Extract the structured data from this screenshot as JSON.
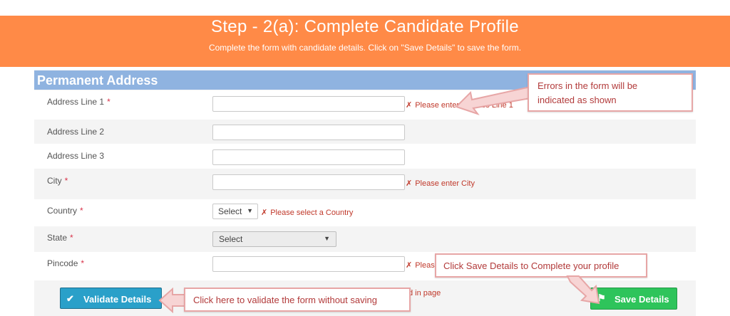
{
  "header": {
    "title": "Step - 2(a): Complete Candidate Profile",
    "subtitle": "Complete the form with candidate details. Click on \"Save Details\" to save the form."
  },
  "section": {
    "title": "Permanent Address"
  },
  "form": {
    "required_mark": "*",
    "error_mark": "✗",
    "address1": {
      "label": "Address Line 1",
      "error": "Please enter Address Line 1"
    },
    "address2": {
      "label": "Address Line 2"
    },
    "address3": {
      "label": "Address Line 3"
    },
    "city": {
      "label": "City",
      "error": "Please enter City"
    },
    "country": {
      "label": "Country",
      "value": "Select",
      "error": "Please select a Country"
    },
    "state": {
      "label": "State",
      "value": "Select"
    },
    "pincode": {
      "label": "Pincode",
      "error_visible": "Pleas"
    }
  },
  "footer": {
    "partial_text": "d in page"
  },
  "buttons": {
    "validate": {
      "label": "Validate Details",
      "icon": "check-icon"
    },
    "save": {
      "label": "Save Details",
      "icon": "flag-icon"
    }
  },
  "callouts": {
    "errors": {
      "line1": "Errors in the form will be",
      "line2": "indicated as shown"
    },
    "save": "Click Save Details to Complete your profile",
    "validate": "Click here to validate the form without saving"
  },
  "colors": {
    "banner": "#ff8a47",
    "section_header": "#8fb3e0",
    "validate_button": "#2aa0c9",
    "save_button": "#2ec45b",
    "error_text": "#c0392b",
    "callout_border": "#e7a6a6"
  }
}
